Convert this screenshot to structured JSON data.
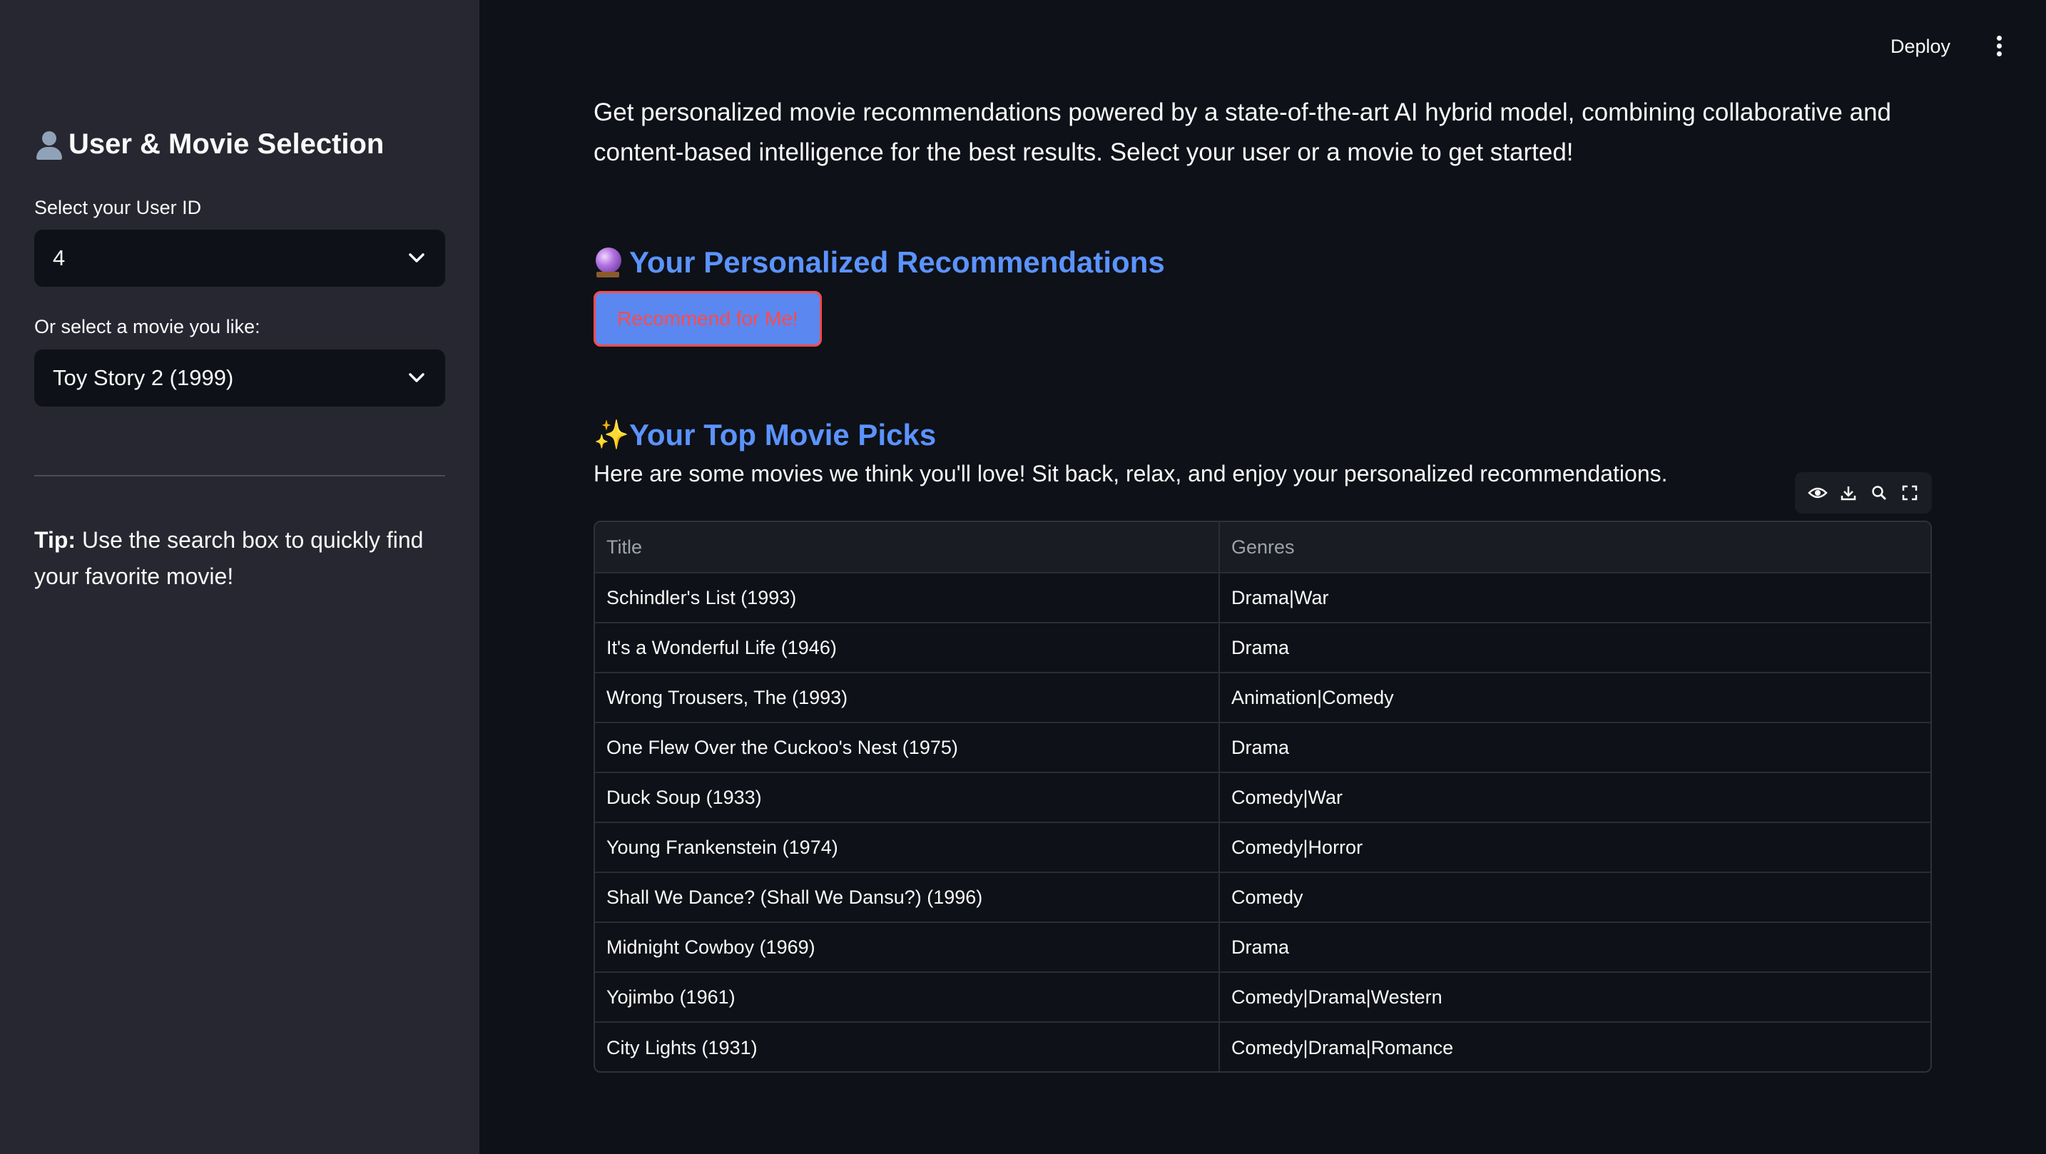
{
  "sidebar": {
    "title": "User & Movie Selection",
    "user_label": "Select your User ID",
    "user_value": "4",
    "movie_label": "Or select a movie you like:",
    "movie_value": "Toy Story 2 (1999)",
    "tip_bold": "Tip:",
    "tip_text": " Use the search box to quickly find your favorite movie!"
  },
  "header": {
    "deploy_label": "Deploy"
  },
  "main": {
    "intro": "Get personalized movie recommendations powered by a state-of-the-art AI hybrid model, combining collaborative and content-based intelligence for the best results. Select your user or a movie to get started!",
    "section1_title": "Your Personalized Recommendations",
    "recommend_button": "Recommend for Me!",
    "section2_title": "Your Top Movie Picks",
    "section2_subtext": "Here are some movies we think you'll love! Sit back, relax, and enjoy your personalized recommendations."
  },
  "table": {
    "columns": [
      "Title",
      "Genres"
    ],
    "rows": [
      [
        "Schindler's List (1993)",
        "Drama|War"
      ],
      [
        "It's a Wonderful Life (1946)",
        "Drama"
      ],
      [
        "Wrong Trousers, The (1993)",
        "Animation|Comedy"
      ],
      [
        "One Flew Over the Cuckoo's Nest (1975)",
        "Drama"
      ],
      [
        "Duck Soup (1933)",
        "Comedy|War"
      ],
      [
        "Young Frankenstein (1974)",
        "Comedy|Horror"
      ],
      [
        "Shall We Dance? (Shall We Dansu?) (1996)",
        "Comedy"
      ],
      [
        "Midnight Cowboy (1969)",
        "Drama"
      ],
      [
        "Yojimbo (1961)",
        "Comedy|Drama|Western"
      ],
      [
        "City Lights (1931)",
        "Comedy|Drama|Romance"
      ]
    ]
  },
  "icons": {
    "user": "user-silhouette-icon",
    "crystal": "crystal-ball-icon",
    "sparkles": "sparkles-icon",
    "eye": "eye-icon",
    "download": "download-icon",
    "search": "search-icon",
    "fullscreen": "fullscreen-icon",
    "menu": "kebab-menu-icon"
  },
  "colors": {
    "background": "#0e1117",
    "sidebar": "#262730",
    "accent": "#5b93ff",
    "button_bg": "#5b87f0",
    "button_text": "#ff4b4b"
  }
}
